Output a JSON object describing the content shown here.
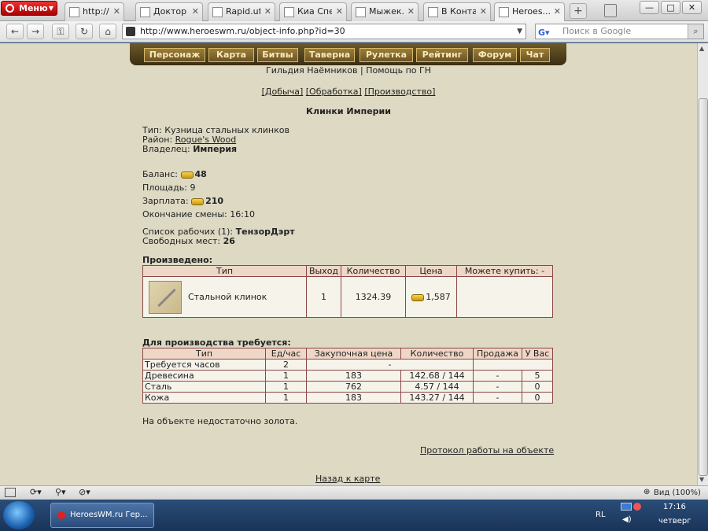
{
  "browser": {
    "menu_label": "Меню",
    "tabs": [
      {
        "label": "http://sk..."
      },
      {
        "label": "Доктор ..."
      },
      {
        "label": "Rapid.uf..."
      },
      {
        "label": "Киа Спе..."
      },
      {
        "label": "Мыжек..."
      },
      {
        "label": "В Конта..."
      },
      {
        "label": "Heroes......"
      }
    ],
    "new_tab": "+",
    "url": "http://www.heroeswm.ru/object-info.php?id=30",
    "search_placeholder": "Поиск в Google",
    "window_buttons": [
      "—",
      "□",
      "✕"
    ]
  },
  "game": {
    "nav": [
      "Персонаж",
      "Карта",
      "Битвы",
      "Таверна",
      "Рулетка",
      "Рейтинг",
      "Форум",
      "Чат"
    ],
    "guild_link": "Гильдия Наёмников",
    "guild_sep": " | ",
    "guild_help": "Помощь по ГН",
    "subnav": [
      "[Добыча]",
      "[Обработка]",
      "[Производство]"
    ],
    "title": "Клинки Империи",
    "type_label": "Тип:",
    "type_value": "Кузница стальных клинков",
    "district_label": "Район:",
    "district_value": "Rogue's Wood",
    "owner_label": "Владелец:",
    "owner_value": "Империя",
    "balance_label": "Баланс:",
    "balance_value": "48",
    "area_label": "Площадь:",
    "area_value": "9",
    "salary_label": "Зарплата:",
    "salary_value": "210",
    "shift_label": "Окончание смены:",
    "shift_value": "16:10",
    "workers_label": "Список рабочих (1):",
    "workers_value": "ТензорДэрт",
    "free_label": "Свободных мест:",
    "free_value": "26",
    "produced_title": "Произведено:",
    "produced_headers": [
      "Тип",
      "Выход",
      "Количество",
      "Цена",
      "Можете купить: -"
    ],
    "produced_row": {
      "name": "Стальной клинок",
      "output": "1",
      "quantity": "1324.39",
      "price": "1,587"
    },
    "required_title": "Для производства требуется:",
    "required_headers": [
      "Тип",
      "Ед/час",
      "Закупочная цена",
      "Количество",
      "Продажа",
      "У Вас"
    ],
    "required_rows": [
      [
        "Требуется часов",
        "2",
        "",
        "-",
        "",
        ""
      ],
      [
        "Древесина",
        "1",
        "183",
        "142.68 / 144",
        "-",
        "5"
      ],
      [
        "Сталь",
        "1",
        "762",
        "4.57 / 144",
        "-",
        "0"
      ],
      [
        "Кожа",
        "1",
        "183",
        "143.27 / 144",
        "-",
        "0"
      ]
    ],
    "notice": "На объекте недостаточно золота.",
    "protocol_link": "Протокол работы на объекте",
    "back_link": "Назад к карте"
  },
  "statusbar": {
    "zoom": "Вид (100%)"
  },
  "taskbar": {
    "app": "HeroesWM.ru Гер...",
    "lang": "RL",
    "time": "17:16",
    "day": "четверг"
  }
}
